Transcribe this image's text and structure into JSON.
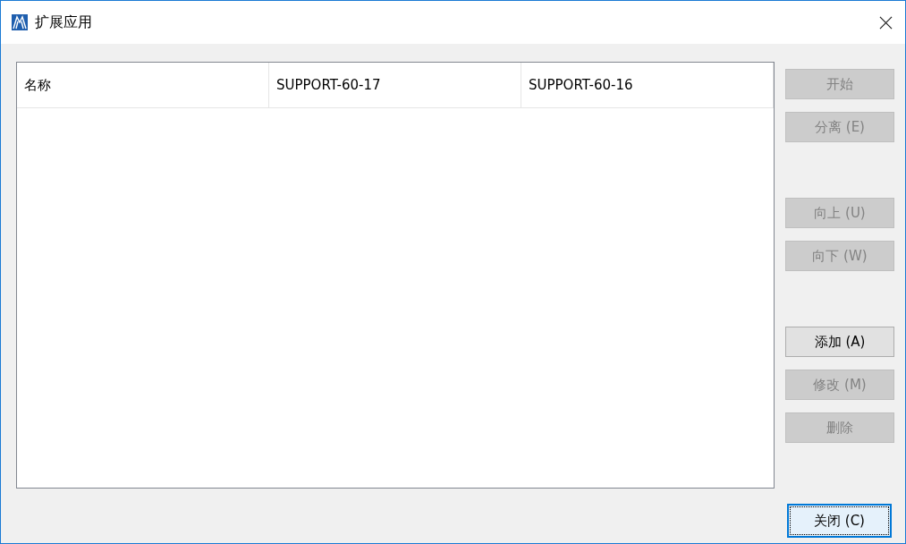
{
  "window": {
    "title": "扩展应用"
  },
  "table": {
    "columns": [
      "名称",
      "SUPPORT-60-17",
      "SUPPORT-60-16"
    ]
  },
  "button_groups": [
    [
      {
        "label": "开始",
        "disabled": true
      },
      {
        "label": "分离 (E)",
        "disabled": true
      }
    ],
    [
      {
        "label": "向上 (U)",
        "disabled": true
      },
      {
        "label": "向下 (W)",
        "disabled": true
      }
    ],
    [
      {
        "label": "添加 (A)",
        "disabled": false
      },
      {
        "label": "修改 (M)",
        "disabled": true
      },
      {
        "label": "删除",
        "disabled": true
      }
    ]
  ],
  "close_button": {
    "label": "关闭 (C)",
    "focused": true
  }
}
